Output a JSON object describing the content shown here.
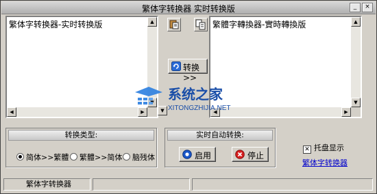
{
  "window": {
    "title": "繁体字转换器 实时转换版",
    "min_glyph": "_",
    "max_glyph": "□",
    "close_glyph": "×"
  },
  "left_pane": {
    "text": "繁体字转换器-实时转换版"
  },
  "right_pane": {
    "text": "繁體字轉換器-實時轉換版"
  },
  "convert_button": {
    "label": "转换>>"
  },
  "conversion_type": {
    "title": "转换类型:",
    "options": [
      {
        "label": "简体>>繁體",
        "selected": true
      },
      {
        "label": "繁體>>简体",
        "selected": false
      },
      {
        "label": "脑残体",
        "selected": false
      }
    ]
  },
  "auto_convert": {
    "title": "实时自动转换:",
    "start_label": "启用",
    "stop_label": "停止"
  },
  "tray": {
    "label": "托盘显示",
    "checked": true
  },
  "link": {
    "label": "繁体字转换器"
  },
  "status": {
    "text": "繁体字转换器"
  },
  "watermark": {
    "brand": "系统之家",
    "url": "XITONGZHIJIA.NET"
  },
  "colors": {
    "link": "#0000cc",
    "start_icon": "#1b57c8",
    "stop_icon": "#d82020"
  }
}
